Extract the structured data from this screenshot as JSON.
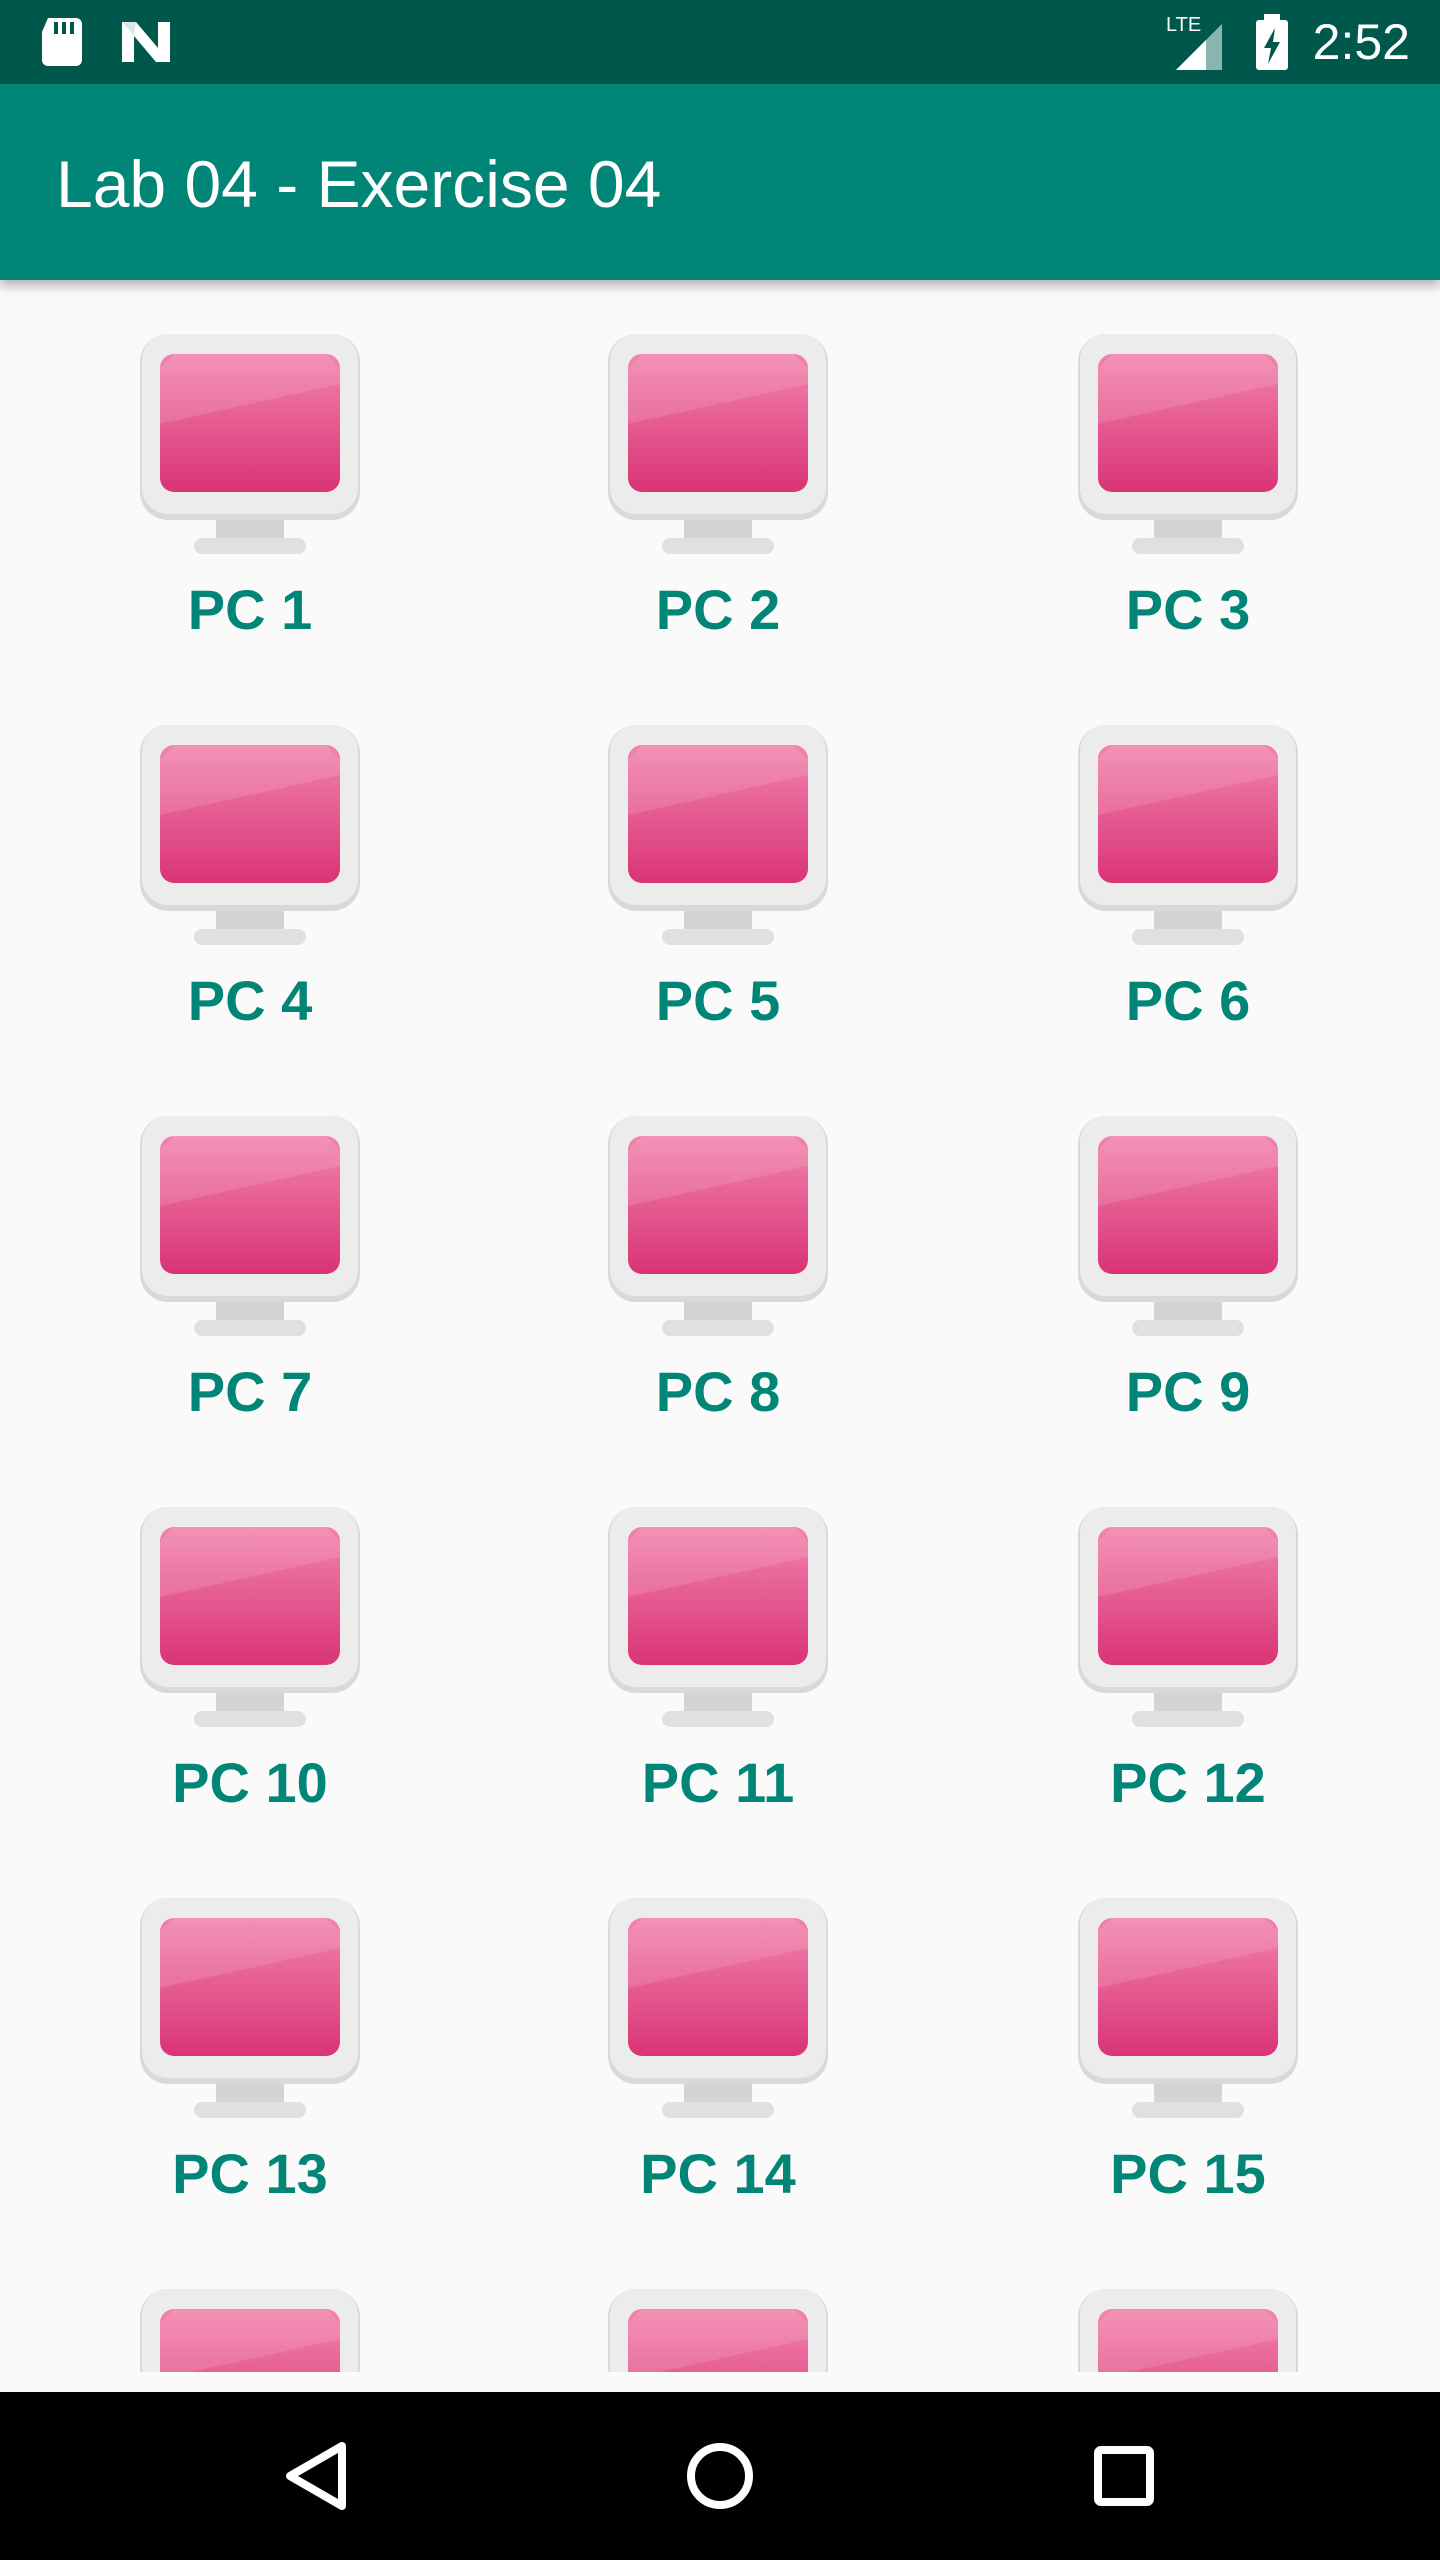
{
  "status_bar": {
    "time": "2:52",
    "network": "LTE",
    "icons": [
      "sd-card-icon",
      "n-notification-icon",
      "lte-signal-icon",
      "battery-charging-icon"
    ]
  },
  "app_bar": {
    "title": "Lab 04 - Exercise 04"
  },
  "grid": {
    "items": [
      {
        "label": "PC 1",
        "icon": "computer-monitor-icon"
      },
      {
        "label": "PC 2",
        "icon": "computer-monitor-icon"
      },
      {
        "label": "PC 3",
        "icon": "computer-monitor-icon"
      },
      {
        "label": "PC 4",
        "icon": "computer-monitor-icon"
      },
      {
        "label": "PC 5",
        "icon": "computer-monitor-icon"
      },
      {
        "label": "PC 6",
        "icon": "computer-monitor-icon"
      },
      {
        "label": "PC 7",
        "icon": "computer-monitor-icon"
      },
      {
        "label": "PC 8",
        "icon": "computer-monitor-icon"
      },
      {
        "label": "PC 9",
        "icon": "computer-monitor-icon"
      },
      {
        "label": "PC 10",
        "icon": "computer-monitor-icon"
      },
      {
        "label": "PC 11",
        "icon": "computer-monitor-icon"
      },
      {
        "label": "PC 12",
        "icon": "computer-monitor-icon"
      },
      {
        "label": "PC 13",
        "icon": "computer-monitor-icon"
      },
      {
        "label": "PC 14",
        "icon": "computer-monitor-icon"
      },
      {
        "label": "PC 15",
        "icon": "computer-monitor-icon"
      },
      {
        "label": "",
        "icon": "computer-monitor-icon"
      },
      {
        "label": "",
        "icon": "computer-monitor-icon"
      },
      {
        "label": "",
        "icon": "computer-monitor-icon"
      }
    ]
  },
  "nav_bar": {
    "buttons": [
      "back-icon",
      "home-icon",
      "recents-icon"
    ]
  },
  "colors": {
    "status_bar": "#00574b",
    "app_bar": "#008577",
    "accent_text": "#008577",
    "screen_pink": "#e0407e",
    "background": "#fafafa"
  }
}
